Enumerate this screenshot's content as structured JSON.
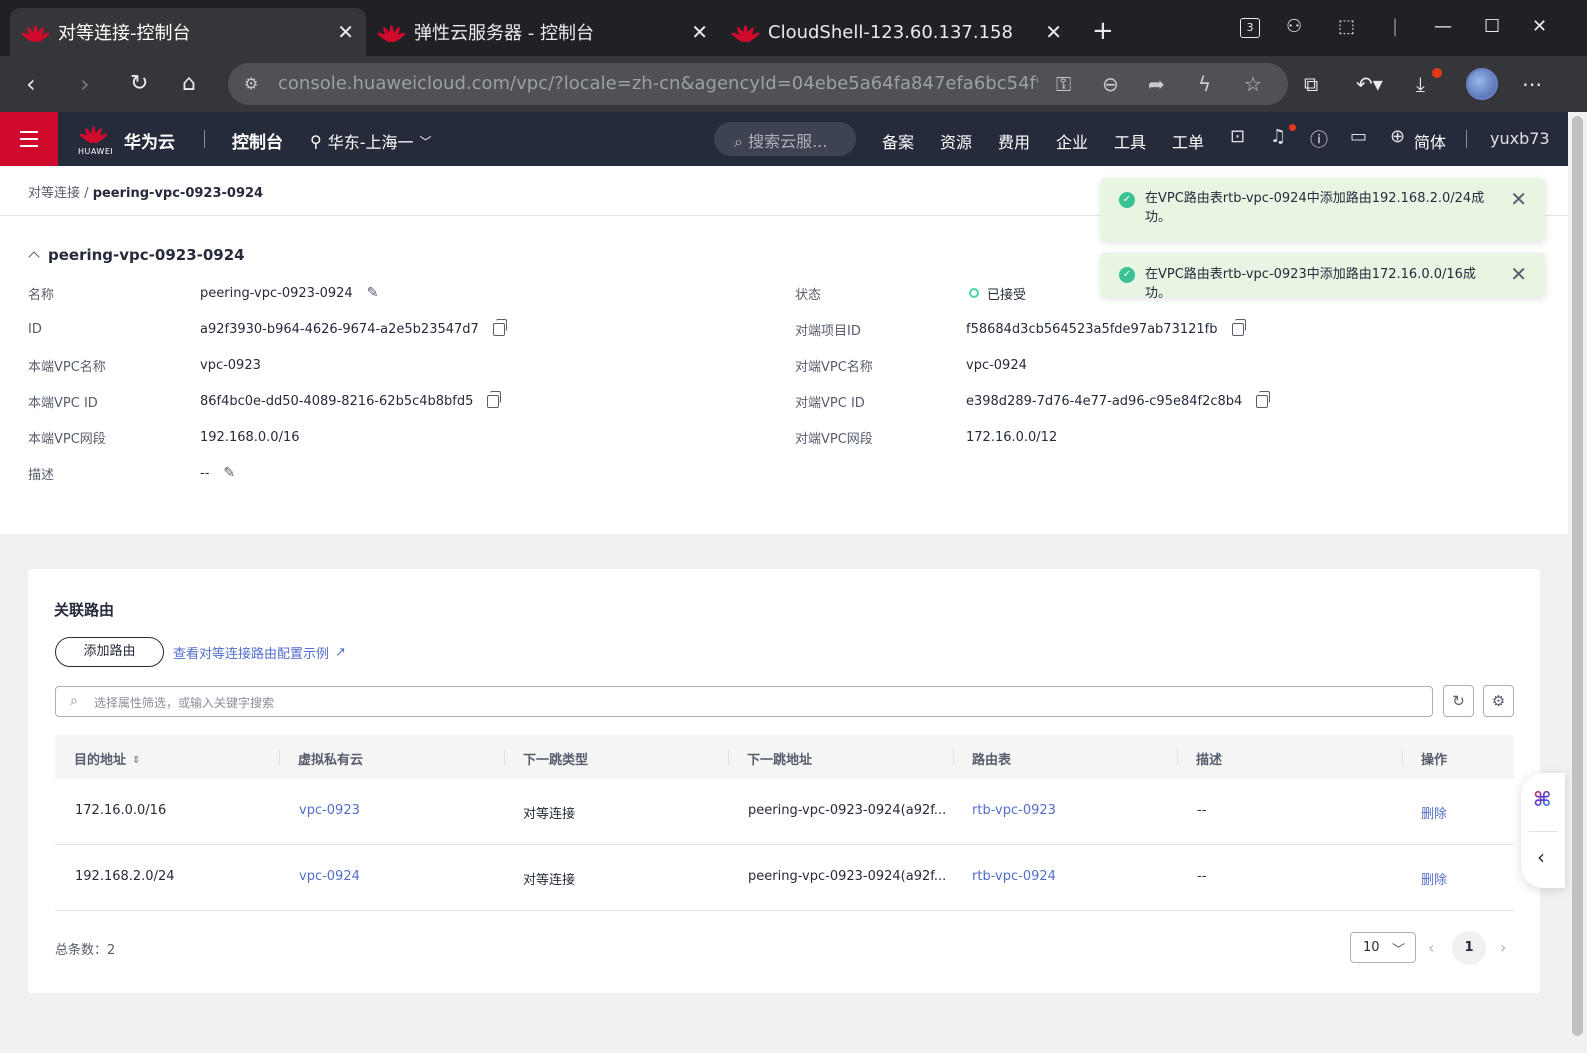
{
  "browser": {
    "tabs": [
      {
        "title": "对等连接-控制台",
        "active": true
      },
      {
        "title": "弹性云服务器 - 控制台",
        "active": false
      },
      {
        "title": "CloudShell-123.60.137.158",
        "active": false
      }
    ],
    "tab_count": "3",
    "url": "console.huaweicloud.com/vpc/?locale=zh-cn&agencyId=04ebe5a64fa847efa6bc54f919..."
  },
  "header": {
    "brand": "华为云",
    "brand_tiny": "HUAWEI",
    "console": "控制台",
    "region": "华东-上海一",
    "search_placeholder": "搜索云服...",
    "nav": [
      "备案",
      "资源",
      "费用",
      "企业",
      "工具",
      "工单"
    ],
    "language": "简体",
    "username": "yuxb73"
  },
  "breadcrumb": {
    "parent": "对等连接",
    "separator": "/",
    "current": "peering-vpc-0923-0924"
  },
  "detail": {
    "title": "peering-vpc-0923-0924",
    "left": [
      {
        "label": "名称",
        "value": "peering-vpc-0923-0924"
      },
      {
        "label": "ID",
        "value": "a92f3930-b964-4626-9674-a2e5b23547d7"
      },
      {
        "label": "本端VPC名称",
        "value": "vpc-0923"
      },
      {
        "label": "本端VPC ID",
        "value": "86f4bc0e-dd50-4089-8216-62b5c4b8bfd5"
      },
      {
        "label": "本端VPC网段",
        "value": "192.168.0.0/16"
      },
      {
        "label": "描述",
        "value": "--"
      }
    ],
    "right": [
      {
        "label": "状态",
        "value": "已接受"
      },
      {
        "label": "对端项目ID",
        "value": "f58684d3cb564523a5fde97ab73121fb"
      },
      {
        "label": "对端VPC名称",
        "value": "vpc-0924"
      },
      {
        "label": "对端VPC ID",
        "value": "e398d289-7d76-4e77-ad96-c95e84f2c8b4"
      },
      {
        "label": "对端VPC网段",
        "value": "172.16.0.0/12"
      }
    ]
  },
  "routes": {
    "title": "关联路由",
    "add_button": "添加路由",
    "example_link": "查看对等连接路由配置示例",
    "filter_placeholder": "选择属性筛选，或输入关键字搜索",
    "columns": [
      "目的地址",
      "虚拟私有云",
      "下一跳类型",
      "下一跳地址",
      "路由表",
      "描述",
      "操作"
    ],
    "rows": [
      {
        "dest": "172.16.0.0/16",
        "vpc": "vpc-0923",
        "hop_type": "对等连接",
        "hop_addr": "peering-vpc-0923-0924(a92f...",
        "route_table": "rtb-vpc-0923",
        "desc": "--",
        "action": "删除"
      },
      {
        "dest": "192.168.2.0/24",
        "vpc": "vpc-0924",
        "hop_type": "对等连接",
        "hop_addr": "peering-vpc-0923-0924(a92f...",
        "route_table": "rtb-vpc-0924",
        "desc": "--",
        "action": "删除"
      }
    ],
    "total_label": "总条数：2",
    "page_size": "10",
    "current_page": "1"
  },
  "toasts": [
    {
      "message": "在VPC路由表rtb-vpc-0924中添加路由192.168.2.0/24成功。"
    },
    {
      "message": "在VPC路由表rtb-vpc-0923中添加路由172.16.0.0/16成功。"
    }
  ],
  "colors": {
    "brand_red": "#cf0a2c",
    "header_bg": "#252b3a",
    "link_blue": "#526ecc",
    "success_green": "#50d4ab",
    "toast_bg": "#e8f5e3"
  }
}
